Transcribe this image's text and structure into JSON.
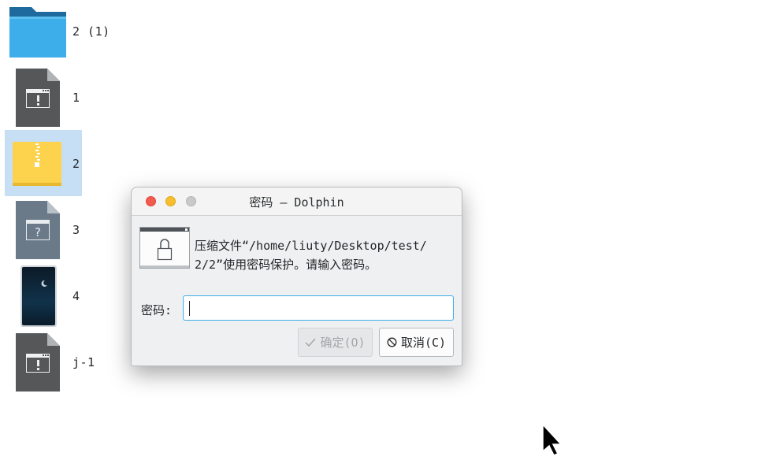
{
  "desktop": {
    "items": [
      {
        "label": "2 (1)",
        "icon": "folder-icon"
      },
      {
        "label": "1",
        "icon": "executable-file-icon"
      },
      {
        "label": "2",
        "icon": "archive-file-icon",
        "selected": true
      },
      {
        "label": "3",
        "icon": "unknown-file-icon"
      },
      {
        "label": "4",
        "icon": "image-file-icon"
      },
      {
        "label": "j-1",
        "icon": "executable-file-icon"
      }
    ]
  },
  "dialog": {
    "title": "密码 — Dolphin",
    "message_line1": "压缩文件“/home/liuty/Desktop/test/",
    "message_line2": "2/2”使用密码保护。请输入密码。",
    "password_label": "密码:",
    "password_value": "",
    "ok_label": "确定(O)",
    "ok_enabled": false,
    "cancel_label": "取消(C)"
  },
  "colors": {
    "selection": "#c6dff5",
    "accent": "#3daee9",
    "close": "#f25b4f",
    "minimize": "#f7bf2e",
    "maximize": "#c9c9c9"
  }
}
